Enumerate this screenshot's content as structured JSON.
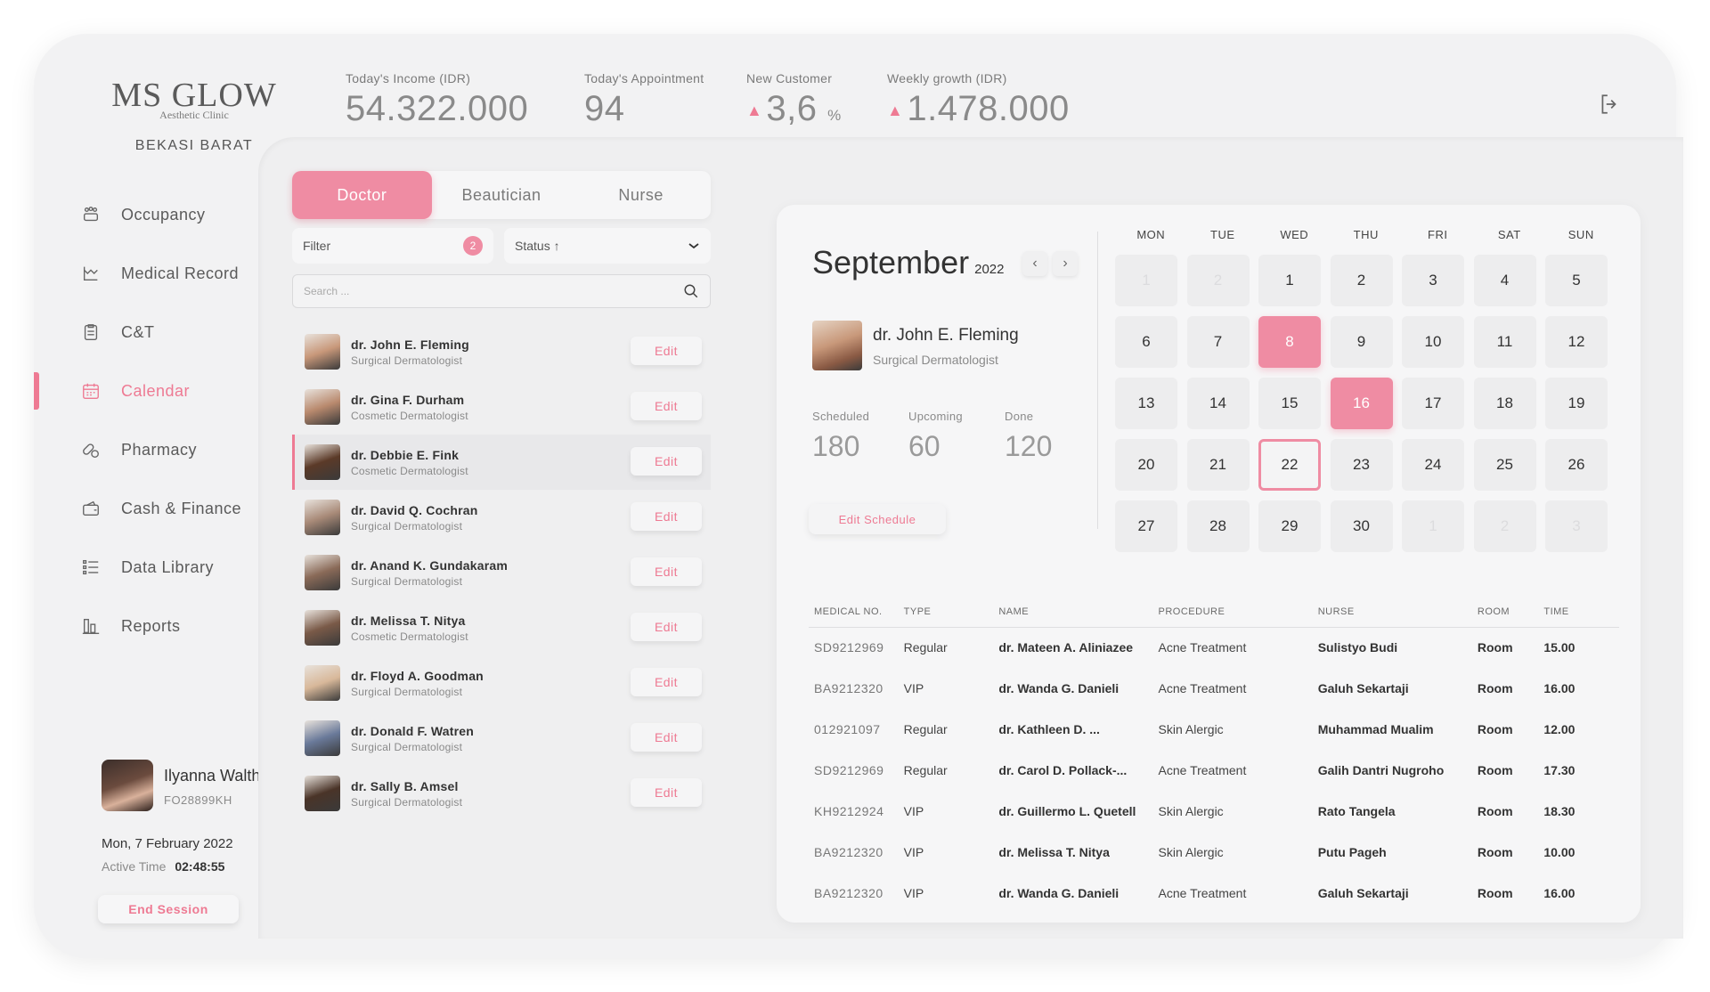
{
  "brand": {
    "name": "MS GLOW",
    "tagline": "Aesthetic Clinic",
    "branch": "BEKASI BARAT"
  },
  "nav": [
    {
      "label": "Occupancy",
      "icon": "occupancy-icon",
      "active": false
    },
    {
      "label": "Medical Record",
      "icon": "medical-record-icon",
      "active": false
    },
    {
      "label": "C&T",
      "icon": "clipboard-icon",
      "active": false
    },
    {
      "label": "Calendar",
      "icon": "calendar-icon",
      "active": true
    },
    {
      "label": "Pharmacy",
      "icon": "pill-icon",
      "active": false
    },
    {
      "label": "Cash & Finance",
      "icon": "wallet-icon",
      "active": false
    },
    {
      "label": "Data Library",
      "icon": "list-icon",
      "active": false
    },
    {
      "label": "Reports",
      "icon": "bar-chart-icon",
      "active": false
    }
  ],
  "stats": [
    {
      "caption": "Today's Income (IDR)",
      "value": "54.322.000",
      "up": false,
      "unit": ""
    },
    {
      "caption": "Today's Appointment",
      "value": "94",
      "up": false,
      "unit": ""
    },
    {
      "caption": "New Customer",
      "value": "3,6",
      "up": true,
      "unit": "%"
    },
    {
      "caption": "Weekly growth (IDR)",
      "value": "1.478.000",
      "up": true,
      "unit": ""
    }
  ],
  "user": {
    "name": "Ilyanna Waltham",
    "id": "FO28899KH",
    "date": "Mon, 7 February 2022",
    "active_label": "Active Time",
    "active_time": "02:48:55",
    "end_label": "End Session"
  },
  "tabs": [
    {
      "label": "Doctor",
      "active": true
    },
    {
      "label": "Beautician",
      "active": false
    },
    {
      "label": "Nurse",
      "active": false
    }
  ],
  "filter": {
    "label": "Filter",
    "count": "2"
  },
  "status": {
    "label": "Status ↑"
  },
  "search": {
    "placeholder": "Search ..."
  },
  "edit_label": "Edit",
  "staff": [
    {
      "name": "dr. John E. Fleming",
      "spec": "Surgical Dermatologist",
      "selected": false,
      "tone": "#c8987a"
    },
    {
      "name": "dr. Gina F. Durham",
      "spec": "Cosmetic Dermatologist",
      "selected": false,
      "tone": "#b98a6e"
    },
    {
      "name": "dr. Debbie E. Fink",
      "spec": "Cosmetic Dermatologist",
      "selected": true,
      "tone": "#5b3a28"
    },
    {
      "name": "dr. David Q. Cochran",
      "spec": "Surgical Dermatologist",
      "selected": false,
      "tone": "#a88a78"
    },
    {
      "name": "dr. Anand K. Gundakaram",
      "spec": "Surgical Dermatologist",
      "selected": false,
      "tone": "#8a6a58"
    },
    {
      "name": "dr. Melissa T. Nitya",
      "spec": "Cosmetic Dermatologist",
      "selected": false,
      "tone": "#7a5a48"
    },
    {
      "name": "dr. Floyd A. Goodman",
      "spec": "Surgical Dermatologist",
      "selected": false,
      "tone": "#d8b89a"
    },
    {
      "name": "dr. Donald F. Watren",
      "spec": "Surgical Dermatologist",
      "selected": false,
      "tone": "#6a7a9a"
    },
    {
      "name": "dr. Sally B. Amsel",
      "spec": "Surgical Dermatologist",
      "selected": false,
      "tone": "#4a3428"
    }
  ],
  "calendar": {
    "month": "September",
    "year": "2022",
    "doctor": {
      "name": "dr. John E. Fleming",
      "spec": "Surgical Dermatologist"
    },
    "counts": [
      {
        "label": "Scheduled",
        "value": "180"
      },
      {
        "label": "Upcoming",
        "value": "60"
      },
      {
        "label": "Done",
        "value": "120"
      }
    ],
    "edit_label": "Edit Schedule",
    "weekdays": [
      "MON",
      "TUE",
      "WED",
      "THU",
      "FRI",
      "SAT",
      "SUN"
    ],
    "days": [
      {
        "n": "1",
        "muted": true
      },
      {
        "n": "2",
        "muted": true
      },
      {
        "n": "1"
      },
      {
        "n": "2"
      },
      {
        "n": "3"
      },
      {
        "n": "4"
      },
      {
        "n": "5"
      },
      {
        "n": "6"
      },
      {
        "n": "7"
      },
      {
        "n": "8",
        "hl": true
      },
      {
        "n": "9"
      },
      {
        "n": "10"
      },
      {
        "n": "11"
      },
      {
        "n": "12"
      },
      {
        "n": "13"
      },
      {
        "n": "14"
      },
      {
        "n": "15"
      },
      {
        "n": "16",
        "hl": true
      },
      {
        "n": "17"
      },
      {
        "n": "18"
      },
      {
        "n": "19"
      },
      {
        "n": "20"
      },
      {
        "n": "21"
      },
      {
        "n": "22",
        "today": true
      },
      {
        "n": "23"
      },
      {
        "n": "24"
      },
      {
        "n": "25"
      },
      {
        "n": "26"
      },
      {
        "n": "27"
      },
      {
        "n": "28"
      },
      {
        "n": "29"
      },
      {
        "n": "30"
      },
      {
        "n": "1",
        "muted": true
      },
      {
        "n": "2",
        "muted": true
      },
      {
        "n": "3",
        "muted": true
      }
    ]
  },
  "table": {
    "headers": [
      "MEDICAL NO.",
      "TYPE",
      "NAME",
      "PROCEDURE",
      "NURSE",
      "ROOM",
      "TIME"
    ],
    "rows": [
      [
        "SD9212969",
        "Regular",
        "dr. Mateen A. Aliniazee",
        "Acne Treatment",
        "Sulistyo Budi",
        "Room",
        "15.00"
      ],
      [
        "BA9212320",
        "VIP",
        "dr. Wanda G. Danieli",
        "Acne Treatment",
        "Galuh Sekartaji",
        "Room",
        "16.00"
      ],
      [
        "012921097",
        "Regular",
        "dr. Kathleen D. ...",
        "Skin Alergic",
        "Muhammad Mualim",
        "Room",
        "12.00"
      ],
      [
        "SD9212969",
        "Regular",
        "dr. Carol D. Pollack-...",
        "Acne Treatment",
        "Galih Dantri Nugroho",
        "Room",
        "17.30"
      ],
      [
        "KH9212924",
        "VIP",
        "dr. Guillermo L. Quetell",
        "Skin Alergic",
        "Rato Tangela",
        "Room",
        "18.30"
      ],
      [
        "BA9212320",
        "VIP",
        "dr. Melissa T. Nitya",
        "Skin Alergic",
        "Putu Pageh",
        "Room",
        "10.00"
      ],
      [
        "BA9212320",
        "VIP",
        "dr. Wanda G. Danieli",
        "Acne Treatment",
        "Galuh Sekartaji",
        "Room",
        "16.00"
      ]
    ]
  }
}
